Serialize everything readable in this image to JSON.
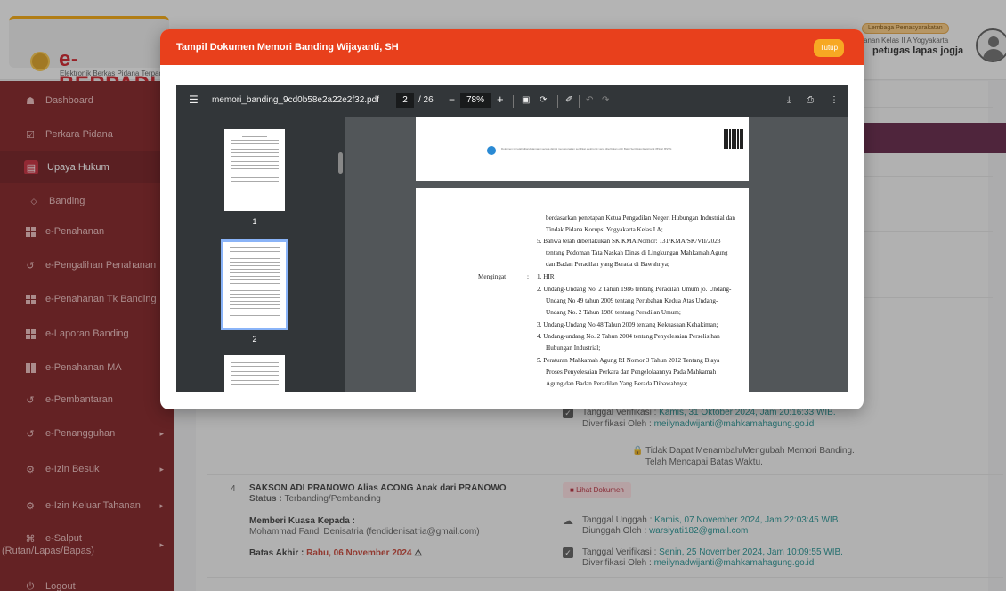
{
  "header": {
    "app_title": "e-BERPADU",
    "app_subtitle": "Elektronik Berkas Pidana Terpadu",
    "institution_badge": "Lembaga Pemasyarakatan",
    "institution_name": "anan Kelas II A Yogyakarta",
    "user_name": "petugas lapas jogja"
  },
  "sidebar": {
    "items": [
      {
        "label": "Dashboard",
        "icon": "home-icon"
      },
      {
        "label": "Perkara Pidana",
        "icon": "checkbox-icon"
      },
      {
        "label": "Upaya Hukum",
        "icon": "document-icon",
        "active": true
      },
      {
        "label": "Banding",
        "icon": "diamond-icon"
      },
      {
        "label": "e-Penahanan",
        "icon": "grid-icon"
      },
      {
        "label": "e-Pengalihan Penahanan",
        "icon": "history-icon"
      },
      {
        "label": "e-Penahanan Tk Banding",
        "icon": "grid-icon"
      },
      {
        "label": "e-Laporan Banding",
        "icon": "grid-icon"
      },
      {
        "label": "e-Penahanan MA",
        "icon": "grid-icon"
      },
      {
        "label": "e-Pembantaran",
        "icon": "history-icon"
      },
      {
        "label": "e-Penangguhan",
        "icon": "history-icon"
      },
      {
        "label": "e-Izin Besuk",
        "icon": "gear-icon"
      },
      {
        "label": "e-Izin Keluar Tahanan",
        "icon": "gear-icon"
      },
      {
        "label": "e-Salput",
        "icon": "command-icon"
      },
      {
        "label": "(Rutan/Lapas/Bapas)",
        "icon": ""
      },
      {
        "label": "Logout",
        "icon": "power-icon"
      }
    ]
  },
  "background": {
    "verif1_date_label": "Tanggal Verifikasi : ",
    "verif1_date": "Kamis, 31 Oktober 2024, Jam 20:16:33 WIB.",
    "verif1_by_label": "Diverifikasi Oleh : ",
    "verif1_by": "meilynadwijanti@mahkamahagung.go.id",
    "lock_text_1": "Tidak Dapat Menambah/Mengubah Memori Banding.",
    "lock_text_2": "Telah Mencapai Batas Waktu.",
    "row_number": "4",
    "row_name": "SAKSON ADI PRANOWO Alias ACONG Anak dari PRANOWO",
    "row_status_label": "Status : ",
    "row_status": "Terbanding/Pembanding",
    "kuasa_label": "Memberi Kuasa Kepada :",
    "kuasa_value": "Mohammad Fandi Denisatria (fendidenisatria@gmail.com)",
    "batas_label": "Batas Akhir : ",
    "batas_value": "Rabu, 06 November 2024",
    "lihat_button": "Lihat Dokumen",
    "upload_date_label": "Tanggal Unggah : ",
    "upload_date": "Kamis, 07 November 2024, Jam 22:03:45 WIB.",
    "upload_by_label": "Diunggah Oleh : ",
    "upload_by": "warsiyati182@gmail.com",
    "verif2_date_label": "Tanggal Verifikasi : ",
    "verif2_date": "Senin, 25 November 2024, Jam 10:09:55 WIB.",
    "verif2_by_label": "Diverifikasi Oleh : ",
    "verif2_by": "meilynadwijanti@mahkamahagung.go.id"
  },
  "modal": {
    "title": "Tampil Dokumen Memori Banding Wijayanti, SH",
    "close_label": "Tutup"
  },
  "pdf": {
    "filename": "memori_banding_9cd0b58e2a22e2f32.pdf",
    "current_page": "2",
    "total_pages": "/ 26",
    "zoom": "78%",
    "thumb_labels": [
      "1",
      "2"
    ],
    "page1_note": "Dokumen ini telah ditandatangani secara digital menggunakan sertifikat elektronik yang diterbitkan oleh Balai Sertifikasi Elektronik (BSrE) BSSN.",
    "page2_lines": [
      "berdasarkan penetapan Ketua Pengadilan Negeri Hubungan Industrial dan",
      "Tindak Pidana Korupsi Yogyakarta Kelas I A;",
      "5.  Bahwa telah diberlakukan SK KMA Nomor: 131/KMA/SK/VII/2023",
      "tentang Pedoman Tata Naskah Dinas di Lingkungan Mahkamah Agung",
      "dan Badan Peradilan yang Berada di Bawahnya;",
      "1.  HIR",
      "2.  Undang-Undang No. 2 Tahun 1986 tentang Peradilan Umum jo. Undang-",
      "Undang No 49 tahun 2009 tentang Perubahan Kedua Atas Undang-",
      "Undang No. 2 Tahun 1986 tentang Peradilan Umum;",
      "3.  Undang-Undang No 48 Tahun 2009 tentang Kekuasaan Kehakiman;",
      "4.  Undang-undang No. 2 Tahun 2004 tentang Penyelesaian Perselisihan",
      "Hubungan Industrial;",
      "5.  Peraturan Mahkamah Agung RI Nomor 3 Tahun 2012 Tentang Biaya",
      "Proses Penyelesaian Perkara dan Pengelolaannya Pada Mahkamah",
      "Agung dan Badan Peradilan Yang Berada Dibawahnya;"
    ],
    "mengingat_label": "Mengingat",
    "mengingat_colon": ":"
  },
  "colors": {
    "modal_header": "#e8401c",
    "close_button": "#f7a823",
    "sidebar": "#7a1418",
    "pdf_toolbar": "#323639"
  }
}
